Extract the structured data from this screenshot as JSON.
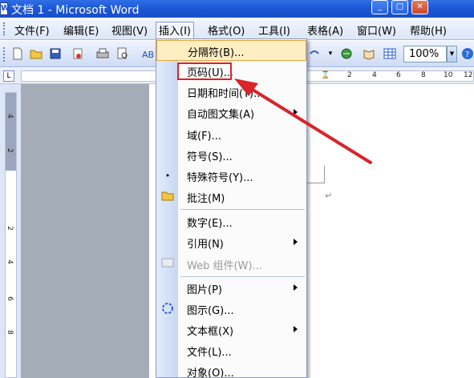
{
  "window": {
    "title": "文档 1 - Microsoft Word",
    "icon": "word-doc-icon"
  },
  "menubar": {
    "items": [
      {
        "label": "文件(F)"
      },
      {
        "label": "编辑(E)"
      },
      {
        "label": "视图(V)"
      },
      {
        "label": "插入(I)"
      },
      {
        "label": "格式(O)"
      },
      {
        "label": "工具(I)"
      },
      {
        "label": "表格(A)"
      },
      {
        "label": "窗口(W)"
      },
      {
        "label": "帮助(H)"
      }
    ],
    "open_menu": "插入(I)"
  },
  "toolbar": {
    "zoom_value": "100%",
    "icons": [
      "new-document-icon",
      "open-folder-icon",
      "save-icon",
      "permission-icon",
      "print-icon",
      "print-preview-icon",
      "spelling-icon",
      "hyperlink-icon",
      "reading-icon",
      "table-icon",
      "dropdown-arrow-icon",
      "help-icon"
    ]
  },
  "ruler": {
    "horizontal_numbers": [
      "2",
      "2",
      "4",
      "6",
      "8",
      "10",
      "12"
    ],
    "vertical_numbers": [
      "4",
      "2",
      "1",
      "2",
      "4",
      "6",
      "8"
    ],
    "tab_selector": "L"
  },
  "insert_menu": {
    "items": [
      {
        "label": "分隔符(B)...",
        "state": "hover"
      },
      {
        "label": "页码(U)...",
        "state": "annotated"
      },
      {
        "label": "日期和时间(T)..."
      },
      {
        "label": "自动图文集(A)",
        "submenu": true
      },
      {
        "label": "域(F)..."
      },
      {
        "label": "符号(S)..."
      },
      {
        "label": "特殊符号(Y)..."
      },
      {
        "label": "批注(M)"
      },
      {
        "label": "数字(E)..."
      },
      {
        "label": "引用(N)",
        "submenu": true
      },
      {
        "label": "Web 组件(W)...",
        "state": "disabled"
      },
      {
        "label": "图片(P)",
        "submenu": true
      },
      {
        "label": "图示(G)..."
      },
      {
        "label": "文本框(X)",
        "submenu": true
      },
      {
        "label": "文件(L)..."
      },
      {
        "label": "对象(O)..."
      }
    ]
  },
  "colors": {
    "titlebar": "#1b55d4",
    "annotation": "#d8242a",
    "menu_hover": "#ffeec2"
  }
}
